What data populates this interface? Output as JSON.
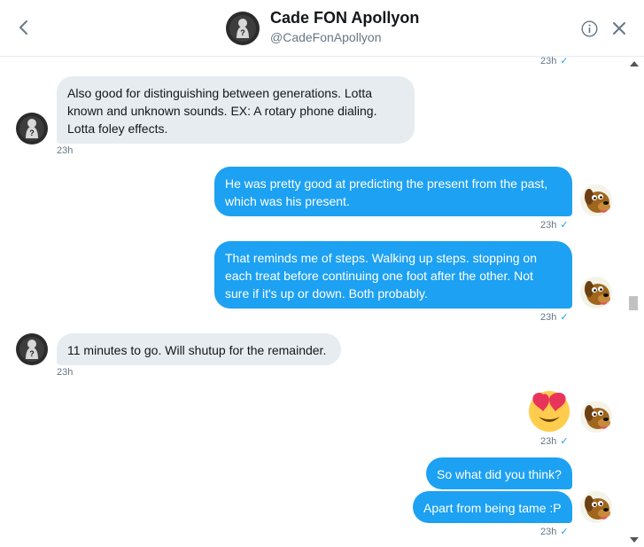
{
  "header": {
    "name": "Cade FON Apollyon",
    "handle": "@CadeFonApollyon"
  },
  "colors": {
    "accent": "#1da1f2",
    "incoming_bg": "#e6ecf0"
  },
  "icons": {
    "back": "chevron-left-icon",
    "info": "info-icon",
    "close": "close-icon",
    "read": "checkmark-icon"
  },
  "messages": [
    {
      "from": "me",
      "time": "23h",
      "check": "✓"
    },
    {
      "from": "them",
      "lines": [
        "Also good for distinguishing between generations. Lotta",
        "known and unknown sounds. EX: A rotary phone dialing.",
        "Lotta foley effects."
      ],
      "time": "23h"
    },
    {
      "from": "me",
      "lines": [
        "He was pretty good at predicting the present from the past,",
        "which was his present."
      ],
      "time": "23h",
      "check": "✓"
    },
    {
      "from": "me",
      "lines": [
        "That reminds me of steps. Walking up steps. stopping on",
        "each treat before continuing one foot after the other. Not",
        "sure if it's up or down. Both probably."
      ],
      "time": "23h",
      "check": "✓"
    },
    {
      "from": "them",
      "lines": [
        "11 minutes to go. Will shutup for the remainder."
      ],
      "time": "23h"
    },
    {
      "from": "me",
      "emoji": "heart-eyes-emoji",
      "time": "23h",
      "check": "✓"
    },
    {
      "from": "me",
      "lines": [
        "So what did you think?"
      ]
    },
    {
      "from": "me",
      "lines": [
        "Apart from being tame :P"
      ],
      "time": "23h",
      "check": "✓"
    }
  ]
}
